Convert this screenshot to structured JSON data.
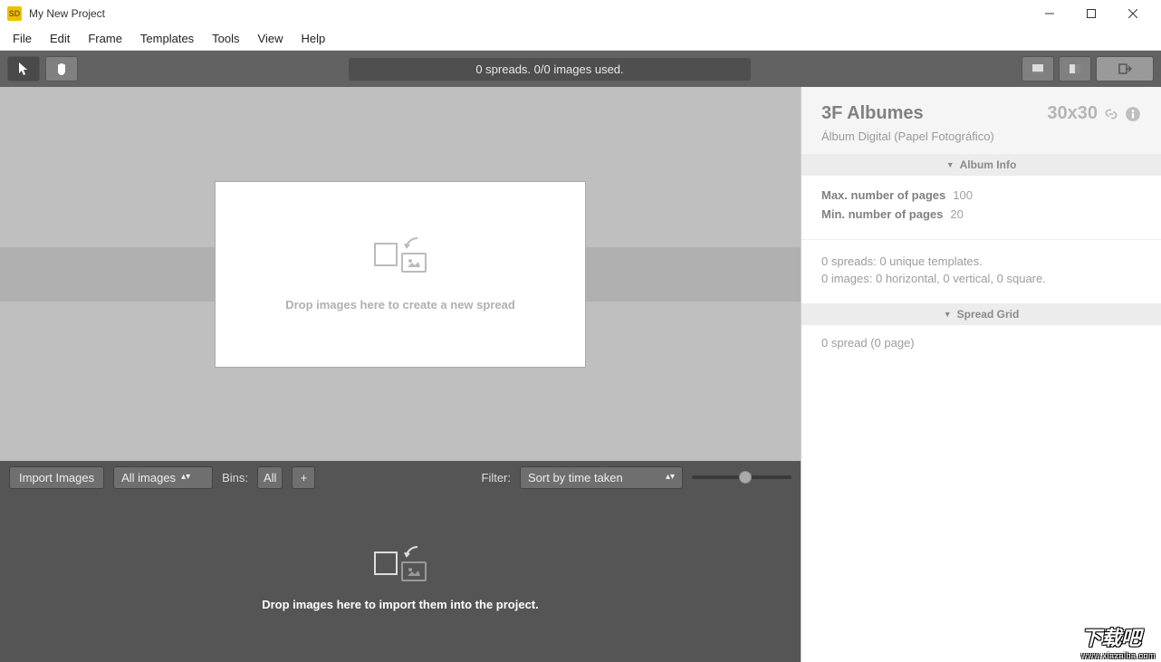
{
  "window": {
    "title": "My New Project"
  },
  "menu": {
    "items": [
      "File",
      "Edit",
      "Frame",
      "Templates",
      "Tools",
      "View",
      "Help"
    ]
  },
  "toolbar": {
    "status": "0 spreads. 0/0 images used."
  },
  "canvas": {
    "drop_hint": "Drop images here to create a new spread"
  },
  "image_bar": {
    "import_label": "Import Images",
    "images_filter": "All images",
    "bins_label": "Bins:",
    "bins_value": "All",
    "plus": "+",
    "filter_label": "Filter:",
    "sort_value": "Sort by time taken"
  },
  "image_drop": {
    "hint": "Drop images here to import them into the project."
  },
  "right": {
    "product_name": "3F Albumes",
    "size": "30x30",
    "subtitle": "Álbum Digital (Papel Fotográfico)",
    "section_album_info": "Album Info",
    "max_pages_label": "Max. number of pages",
    "max_pages_value": "100",
    "min_pages_label": "Min. number of pages",
    "min_pages_value": "20",
    "stats_spreads": "0 spreads:  0 unique templates.",
    "stats_images": "0 images:  0 horizontal, 0 vertical, 0 square.",
    "section_spread_grid": "Spread Grid",
    "grid_summary": "0 spread (0 page)"
  },
  "watermark": {
    "text": "下载吧",
    "url": "www.xiazaiba.com"
  }
}
